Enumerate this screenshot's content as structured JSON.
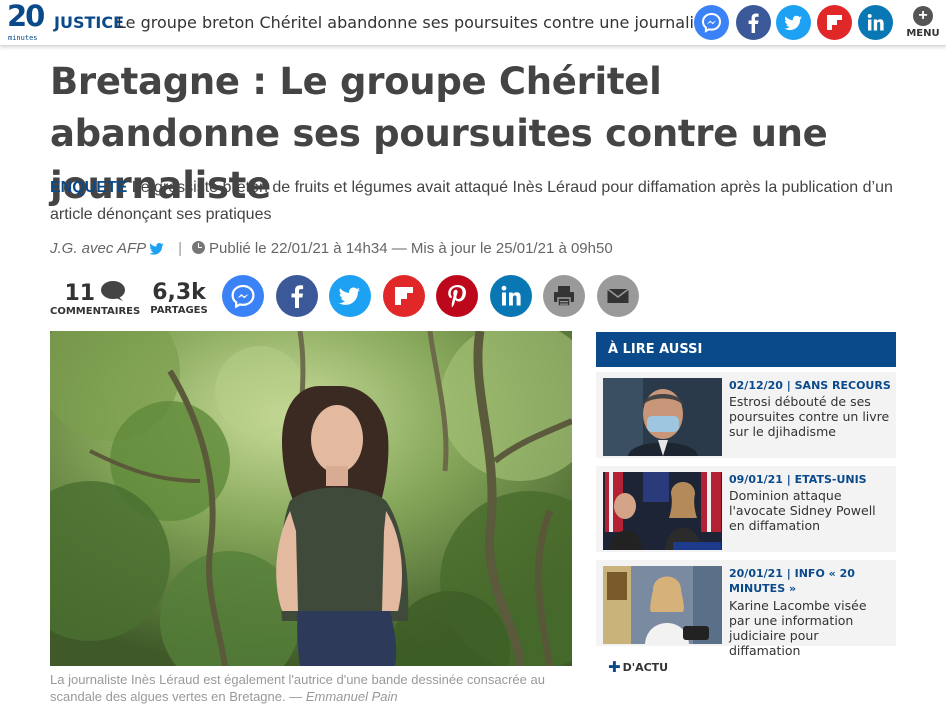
{
  "header": {
    "logo_number": "20",
    "logo_sub": "minutes",
    "rubrique": "JUSTICE",
    "title": "Le groupe breton Chéritel abandonne ses poursuites contre une journaliste",
    "menu_label": "MENU"
  },
  "article": {
    "headline": "Bretagne : Le groupe Chéritel abandonne ses poursuites contre une journaliste",
    "kicker": "ENQUETE",
    "lede": "Le grossiste breton de fruits et légumes avait attaqué Inès Léraud pour diffamation après la publication d’un article dénonçant ses pratiques",
    "author": "J.G. avec AFP",
    "published": "Publié le 22/01/21 à 14h34 — Mis à jour le 25/01/21 à 09h50",
    "comments_count": "11",
    "comments_label": "COMMENTAIRES",
    "shares_count": "6,3k",
    "shares_label": "PARTAGES",
    "caption": "La journaliste Inès Léraud est également l'autrice d'une bande dessinée consacrée au scandale des algues vertes en Bretagne. —",
    "credit": "Emmanuel Pain"
  },
  "share_buttons": [
    {
      "name": "messenger",
      "color": "#3b82f6"
    },
    {
      "name": "facebook",
      "color": "#3b5998"
    },
    {
      "name": "twitter",
      "color": "#1da1f2"
    },
    {
      "name": "flipboard",
      "color": "#e12828"
    },
    {
      "name": "pinterest",
      "color": "#bd081c"
    },
    {
      "name": "linkedin",
      "color": "#0a77b5"
    },
    {
      "name": "print",
      "color": "#999999"
    },
    {
      "name": "email",
      "color": "#999999"
    }
  ],
  "sidebar": {
    "heading": "À LIRE AUSSI",
    "items": [
      {
        "meta": "02/12/20 | SANS RECOURS",
        "title": "Estrosi débouté de ses poursuites contre un livre sur le djihadisme"
      },
      {
        "meta": "09/01/21 | ETATS-UNIS",
        "title": "Dominion attaque l'avocate Sidney Powell en diffamation"
      },
      {
        "meta": "20/01/21 | INFO « 20 MINUTES »",
        "title": "Karine Lacombe visée par une information judiciaire pour diffamation"
      }
    ],
    "more_label": "D'ACTU"
  },
  "colors": {
    "brand": "#0a4a8a",
    "text": "#444444"
  }
}
